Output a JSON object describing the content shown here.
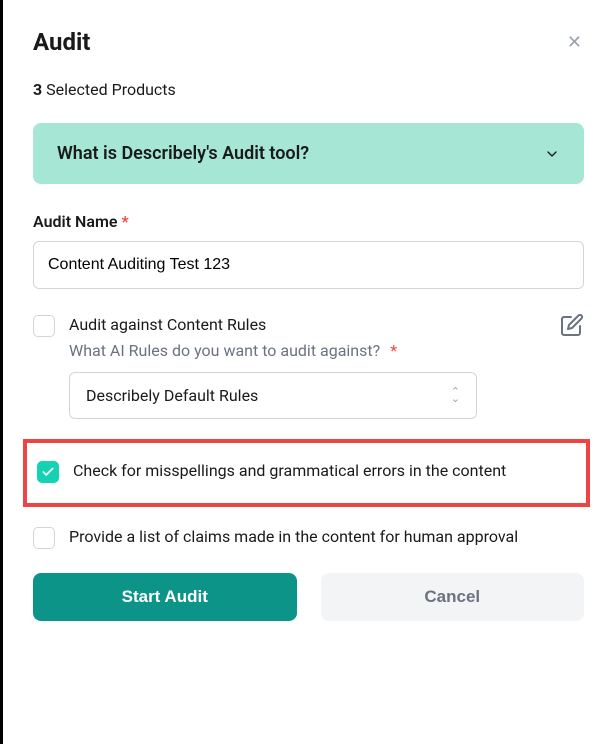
{
  "header": {
    "title": "Audit"
  },
  "selected": {
    "count": "3",
    "label": "Selected Products"
  },
  "accordion": {
    "title": "What is Describely's Audit tool?"
  },
  "auditName": {
    "label": "Audit Name",
    "value": "Content Auditing Test 123"
  },
  "option1": {
    "title": "Audit against Content Rules",
    "subtitle": "What AI Rules do you want to audit against?",
    "selectValue": "Describely Default Rules"
  },
  "option2": {
    "title": "Check for misspellings and grammatical errors in the content"
  },
  "option3": {
    "title": "Provide a list of claims made in the content for human approval"
  },
  "footer": {
    "primary": "Start Audit",
    "secondary": "Cancel"
  }
}
